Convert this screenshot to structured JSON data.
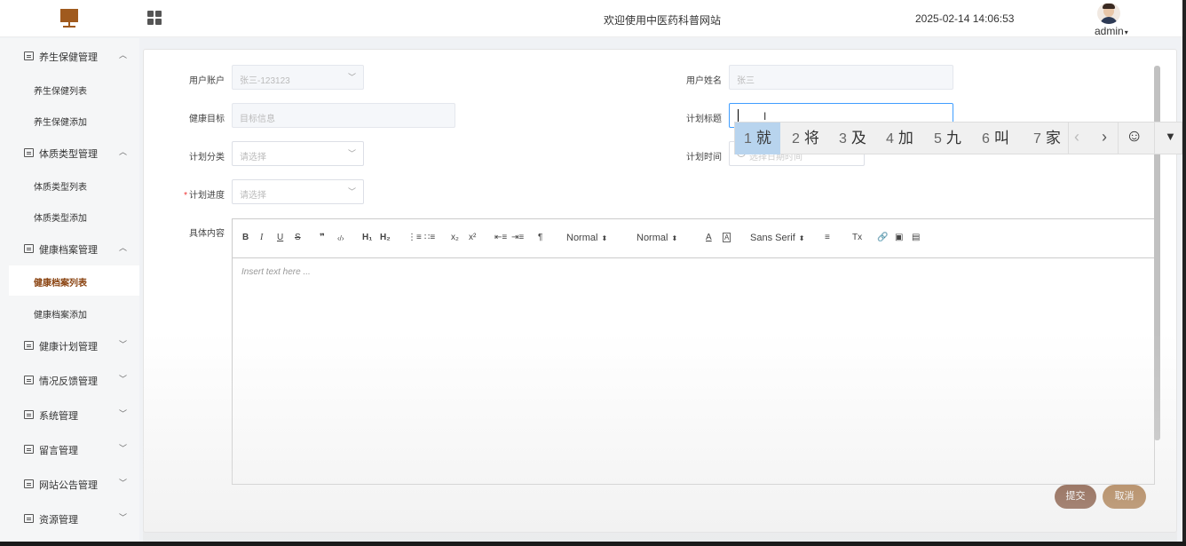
{
  "header": {
    "site_title": "欢迎使用中医药科普网站",
    "datetime": "2025-02-14 14:06:53",
    "user": "admin",
    "logo_icon": "monitor-logo-icon",
    "menu_toggle_icon": "grid-icon",
    "brand_color": "#a05a1e"
  },
  "sidebar": {
    "groups": [
      {
        "label": "养生保健管理",
        "icon": "folder-icon",
        "expanded": true,
        "items": [
          "养生保健列表",
          "养生保健添加"
        ]
      },
      {
        "label": "体质类型管理",
        "icon": "folder-icon",
        "expanded": true,
        "items": [
          "体质类型列表",
          "体质类型添加"
        ]
      },
      {
        "label": "健康档案管理",
        "icon": "folder-icon",
        "expanded": true,
        "items": [
          "健康档案列表",
          "健康档案添加"
        ]
      },
      {
        "label": "健康计划管理",
        "icon": "folder-icon",
        "expanded": false
      },
      {
        "label": "情况反馈管理",
        "icon": "folder-icon",
        "expanded": false
      },
      {
        "label": "系统管理",
        "icon": "settings-icon",
        "expanded": false
      },
      {
        "label": "留言管理",
        "icon": "message-icon",
        "expanded": false
      },
      {
        "label": "网站公告管理",
        "icon": "notice-icon",
        "expanded": false
      },
      {
        "label": "资源管理",
        "icon": "resource-icon",
        "expanded": false
      }
    ],
    "active_item": "健康档案列表",
    "active_color": "#8b4513"
  },
  "form": {
    "user_account": {
      "label": "用户账户",
      "value": "张三-123123"
    },
    "user_name": {
      "label": "用户姓名",
      "value": "张三"
    },
    "health_goal": {
      "label": "健康目标",
      "placeholder": "目标信息"
    },
    "plan_title": {
      "label": "计划标题",
      "value": ""
    },
    "plan_category": {
      "label": "计划分类",
      "placeholder": "请选择"
    },
    "plan_time": {
      "label": "计划时间",
      "placeholder": "选择日期时间"
    },
    "plan_progress": {
      "label": "计划进度",
      "placeholder": "请选择",
      "required_mark": "*"
    },
    "content": {
      "label": "具体内容",
      "placeholder": "Insert text here ..."
    }
  },
  "editor_toolbar": {
    "header_select": "Normal",
    "size_select": "Normal",
    "font_select": "Sans Serif",
    "buttons": [
      "B",
      "I",
      "U",
      "S",
      "❞",
      "‹/›",
      "H₁",
      "H₂",
      "ol",
      "ul",
      "x₂",
      "x²",
      "outdent",
      "indent",
      "¶",
      "A",
      "A",
      "align",
      "Tx",
      "link",
      "image",
      "video"
    ]
  },
  "actions": {
    "submit": "提交",
    "cancel": "取消",
    "submit_color": "#6b2f12",
    "cancel_color": "#9c5f22"
  },
  "ime": {
    "candidates": [
      {
        "n": "1",
        "text": "就"
      },
      {
        "n": "2",
        "text": "将"
      },
      {
        "n": "3",
        "text": "及"
      },
      {
        "n": "4",
        "text": "加"
      },
      {
        "n": "5",
        "text": "九"
      },
      {
        "n": "6",
        "text": "叫"
      },
      {
        "n": "7",
        "text": "家"
      }
    ],
    "prev": "‹",
    "next": "›",
    "emoji": "☺",
    "more": "▼"
  }
}
